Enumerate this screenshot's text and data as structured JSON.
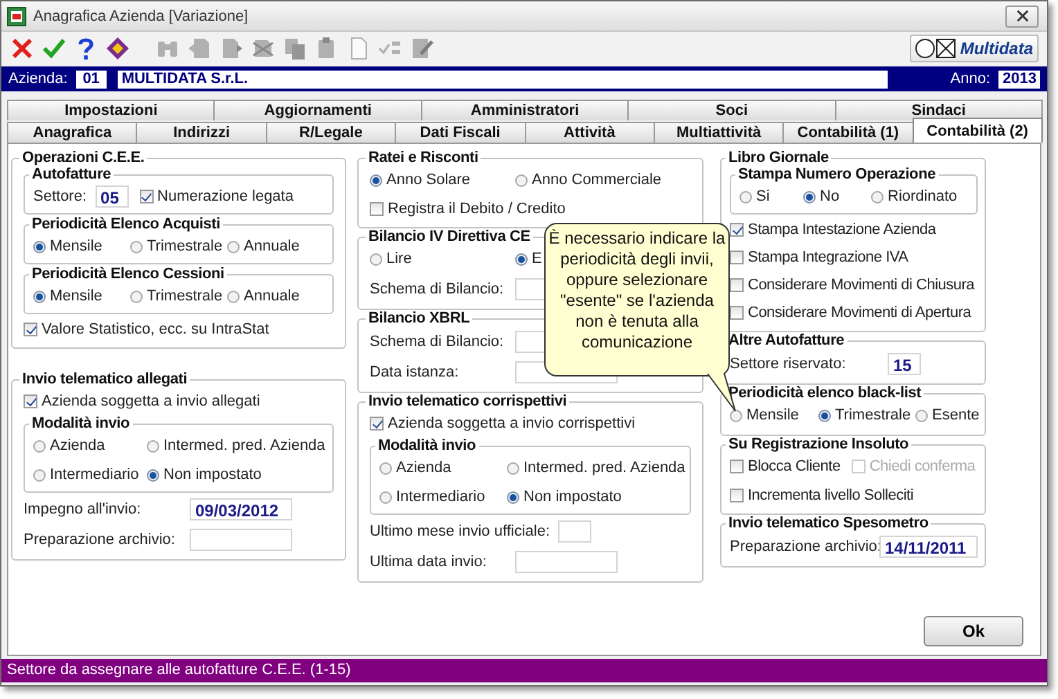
{
  "window": {
    "title": "Anagrafica Azienda [Variazione]"
  },
  "toolbar": [
    {
      "kind": "cancel",
      "disabled": false
    },
    {
      "kind": "confirm",
      "disabled": false
    },
    {
      "kind": "help",
      "disabled": false
    },
    {
      "kind": "diamond",
      "disabled": false
    },
    {
      "kind": "binoculars",
      "disabled": true
    },
    {
      "kind": "doc_left",
      "disabled": true
    },
    {
      "kind": "doc_right",
      "disabled": true
    },
    {
      "kind": "doc_x",
      "disabled": true
    },
    {
      "kind": "copy",
      "disabled": true
    },
    {
      "kind": "paste",
      "disabled": true
    },
    {
      "kind": "new_doc",
      "disabled": true
    },
    {
      "kind": "check_list",
      "disabled": true
    },
    {
      "kind": "edit_doc",
      "disabled": true
    }
  ],
  "logo": {
    "text": "Multidata"
  },
  "header": {
    "company_label": "Azienda:",
    "company_code": "01",
    "company_name": "MULTIDATA S.r.L.",
    "year_label": "Anno:",
    "year": "2013"
  },
  "tabs": [
    [
      {
        "label": "Impostazioni",
        "selected": false
      },
      {
        "label": "Aggiornamenti",
        "selected": false
      },
      {
        "label": "Amministratori",
        "selected": false
      },
      {
        "label": "Soci",
        "selected": false
      },
      {
        "label": "Sindaci",
        "selected": false
      }
    ],
    [
      {
        "label": "Anagrafica",
        "selected": false
      },
      {
        "label": "Indirizzi",
        "selected": false
      },
      {
        "label": "R/Legale",
        "selected": false
      },
      {
        "label": "Dati Fiscali",
        "selected": false
      },
      {
        "label": "Attività",
        "selected": false
      },
      {
        "label": "Multiattività",
        "selected": false
      },
      {
        "label": "Contabilità (1)",
        "selected": false
      },
      {
        "label": "Contabilità (2)",
        "selected": true
      }
    ]
  ],
  "columns": [
    [
      {
        "title": "Operazioni C.E.E.",
        "items": [
          {
            "kind": "group",
            "title": "Autofatture",
            "items": [
              {
                "kind": "row",
                "items": [
                  {
                    "kind": "short_field",
                    "label": "Settore:",
                    "value": "05"
                  },
                  {
                    "kind": "check",
                    "label": "Numerazione legata",
                    "checked": true,
                    "disabled": false
                  }
                ]
              }
            ]
          },
          {
            "kind": "group",
            "title": "Periodicità Elenco Acquisti",
            "items": [
              {
                "kind": "radios",
                "options": [
                  {
                    "label": "Mensile",
                    "selected": true
                  },
                  {
                    "label": "Trimestrale",
                    "selected": false
                  },
                  {
                    "label": "Annuale",
                    "selected": false
                  }
                ]
              }
            ]
          },
          {
            "kind": "group",
            "title": "Periodicità Elenco Cessioni",
            "items": [
              {
                "kind": "radios",
                "options": [
                  {
                    "label": "Mensile",
                    "selected": true
                  },
                  {
                    "label": "Trimestrale",
                    "selected": false
                  },
                  {
                    "label": "Annuale",
                    "selected": false
                  }
                ]
              }
            ]
          },
          {
            "kind": "check",
            "label": "Valore Statistico, ecc. su IntraStat",
            "checked": true,
            "disabled": false
          }
        ]
      },
      {
        "title": "Invio telematico allegati",
        "items": [
          {
            "kind": "check",
            "label": "Azienda soggetta a invio allegati",
            "checked": true,
            "disabled": false
          },
          {
            "kind": "group",
            "title": "Modalità invio",
            "items": [
              {
                "kind": "radios",
                "options": [
                  {
                    "label": "Azienda",
                    "selected": false
                  },
                  {
                    "label": "Intermed. pred. Azienda",
                    "selected": false
                  }
                ]
              },
              {
                "kind": "radios",
                "options": [
                  {
                    "label": "Intermediario",
                    "selected": false
                  },
                  {
                    "label": "Non impostato",
                    "selected": true
                  }
                ]
              }
            ]
          },
          {
            "kind": "field",
            "label": "Impegno all'invio:",
            "value": "09/03/2012"
          },
          {
            "kind": "field",
            "label": "Preparazione archivio:"
          }
        ]
      }
    ],
    [
      {
        "title": "Ratei e Risconti",
        "items": [
          {
            "kind": "radios",
            "options": [
              {
                "label": "Anno Solare",
                "selected": true
              },
              {
                "label": "Anno Commerciale",
                "selected": false
              }
            ]
          },
          {
            "kind": "check",
            "label": "Registra il Debito / Credito",
            "checked": false,
            "disabled": false
          }
        ]
      },
      {
        "title": "Bilancio IV Direttiva CE",
        "items": [
          {
            "kind": "radios",
            "options": [
              {
                "label": "Lire",
                "selected": false
              },
              {
                "label": "E",
                "selected": true
              }
            ]
          },
          {
            "kind": "field",
            "label": "Schema di Bilancio:"
          }
        ]
      },
      {
        "title": "Bilancio XBRL",
        "items": [
          {
            "kind": "field",
            "label": "Schema di Bilancio:"
          },
          {
            "kind": "field",
            "label": "Data istanza:"
          }
        ]
      },
      {
        "title": "Invio telematico corrispettivi",
        "items": [
          {
            "kind": "check",
            "label": "Azienda soggetta a invio corrispettivi",
            "checked": true,
            "disabled": false
          },
          {
            "kind": "group",
            "title": "Modalità invio",
            "items": [
              {
                "kind": "radios",
                "options": [
                  {
                    "label": "Azienda",
                    "selected": false
                  },
                  {
                    "label": "Intermed. pred. Azienda",
                    "selected": false
                  }
                ]
              },
              {
                "kind": "radios",
                "options": [
                  {
                    "label": "Intermediario",
                    "selected": false
                  },
                  {
                    "label": "Non impostato",
                    "selected": true
                  }
                ]
              }
            ]
          },
          {
            "kind": "short_field",
            "label": "Ultimo mese invio ufficiale:"
          },
          {
            "kind": "field",
            "label": "Ultima data invio:"
          }
        ]
      }
    ],
    [
      {
        "title": "Libro Giornale",
        "items": [
          {
            "kind": "group",
            "title": "Stampa Numero Operazione",
            "items": [
              {
                "kind": "radios",
                "options": [
                  {
                    "label": "Si",
                    "selected": false
                  },
                  {
                    "label": "No",
                    "selected": true
                  },
                  {
                    "label": "Riordinato",
                    "selected": false
                  }
                ]
              }
            ]
          },
          {
            "kind": "check",
            "label": "Stampa Intestazione Azienda",
            "checked": true,
            "disabled": false
          },
          {
            "kind": "check",
            "label": "Stampa Integrazione IVA",
            "checked": false,
            "disabled": false
          },
          {
            "kind": "check",
            "label": "Considerare Movimenti di Chiusura",
            "checked": false,
            "disabled": false
          },
          {
            "kind": "check",
            "label": "Considerare Movimenti di Apertura",
            "checked": false,
            "disabled": false
          }
        ]
      },
      {
        "title": "Altre Autofatture",
        "items": [
          {
            "kind": "short_field",
            "label": "Settore riservato:",
            "value": "15"
          }
        ]
      },
      {
        "title": "Periodicità elenco black-list",
        "items": [
          {
            "kind": "radios",
            "options": [
              {
                "label": "Mensile",
                "selected": false
              },
              {
                "label": "Trimestrale",
                "selected": true
              },
              {
                "label": "Esente",
                "selected": false
              }
            ]
          }
        ]
      },
      {
        "title": "Su Registrazione Insoluto",
        "items": [
          {
            "kind": "row",
            "items": [
              {
                "kind": "check",
                "label": "Blocca Cliente",
                "checked": false,
                "disabled": false
              },
              {
                "kind": "check",
                "label": "Chiedi conferma",
                "checked": false,
                "disabled": true
              }
            ]
          },
          {
            "kind": "check",
            "label": "Incrementa livello Solleciti",
            "checked": false,
            "disabled": false
          }
        ]
      },
      {
        "title": "Invio telematico Spesometro",
        "items": [
          {
            "kind": "field",
            "label": "Preparazione archivio:",
            "value": "14/11/2011"
          }
        ]
      }
    ]
  ],
  "tooltip": {
    "text": "È necessario indicare la periodicità degli invii, oppure selezionare \"esente\" se l'azienda non è tenuta alla comunicazione"
  },
  "buttons": [
    {
      "label": "Ok"
    }
  ],
  "status_bar": {
    "text": "Settore da assegnare alle autofatture C.E.E. (1-15)"
  }
}
